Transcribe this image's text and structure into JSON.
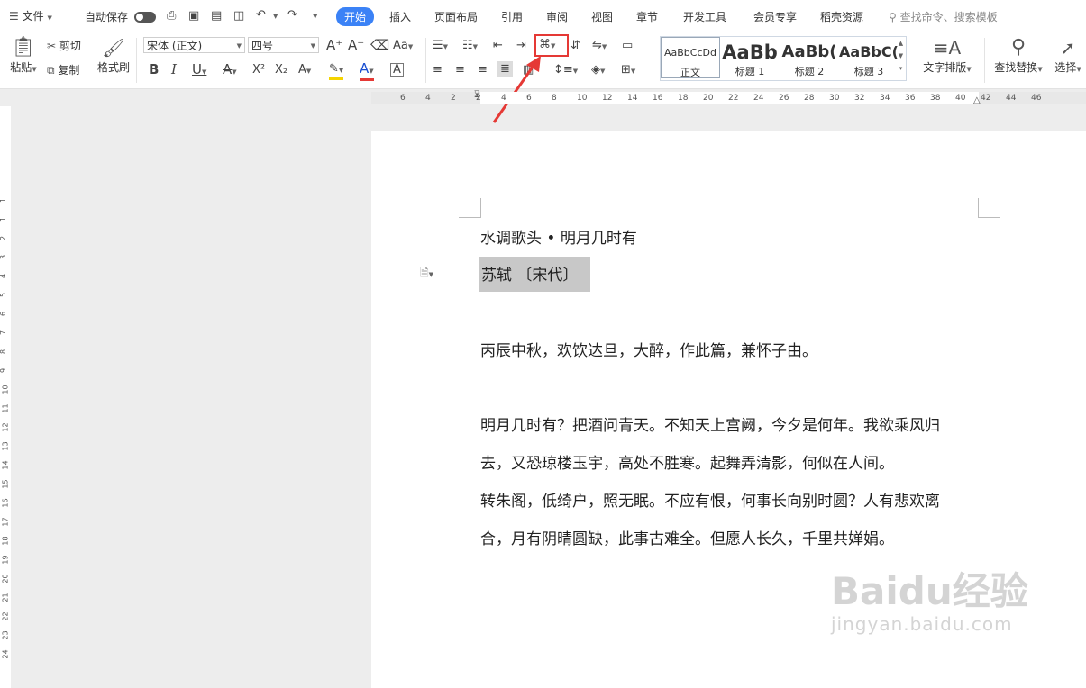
{
  "menu": {
    "file_label": "文件",
    "autosave_label": "自动保存",
    "tabs": [
      "开始",
      "插入",
      "页面布局",
      "引用",
      "审阅",
      "视图",
      "章节",
      "开发工具",
      "会员专享",
      "稻壳资源"
    ],
    "search_placeholder": "查找命令、搜索模板"
  },
  "ribbon": {
    "paste_label": "粘贴",
    "cut_label": "剪切",
    "copy_label": "复制",
    "format_painter_label": "格式刷",
    "font_name": "宋体 (正文)",
    "font_size": "四号",
    "styles": [
      {
        "preview": "AaBbCcDd",
        "name": "正文"
      },
      {
        "preview": "AaBb",
        "name": "标题 1"
      },
      {
        "preview": "AaBb(",
        "name": "标题 2"
      },
      {
        "preview": "AaBbC(",
        "name": "标题 3"
      }
    ],
    "text_layout_label": "文字排版",
    "find_replace_label": "查找替换",
    "select_label": "选择"
  },
  "ruler": {
    "top_numbers": [
      "6",
      "4",
      "2",
      "2",
      "4",
      "6",
      "8",
      "10",
      "12",
      "14",
      "16",
      "18",
      "20",
      "22",
      "24",
      "26",
      "28",
      "30",
      "32",
      "34",
      "36",
      "38",
      "40",
      "42",
      "44",
      "46"
    ],
    "left_numbers": [
      "1",
      "1",
      "2",
      "3",
      "4",
      "5",
      "6",
      "7",
      "8",
      "9",
      "10",
      "11",
      "12",
      "13",
      "14",
      "15",
      "16",
      "17",
      "18",
      "19",
      "20",
      "21",
      "22",
      "23",
      "24"
    ]
  },
  "document": {
    "title": "水调歌头 • 明月几时有",
    "author": "苏轼 〔宋代〕",
    "preface": "丙辰中秋，欢饮达旦，大醉，作此篇，兼怀子由。",
    "lines": [
      "明月几时有？把酒问青天。不知天上宫阙，今夕是何年。我欲乘风归",
      "去，又恐琼楼玉宇，高处不胜寒。起舞弄清影，何似在人间。",
      "转朱阁，低绮户，照无眠。不应有恨，何事长向别时圆？人有悲欢离",
      "合，月有阴晴圆缺，此事古难全。但愿人长久，千里共婵娟。"
    ]
  },
  "watermark": {
    "brand": "Baidu经验",
    "url": "jingyan.baidu.com"
  },
  "colors": {
    "accent": "#3b82f6",
    "highlight_box": "#e53935",
    "selection": "#c8c8c8"
  }
}
